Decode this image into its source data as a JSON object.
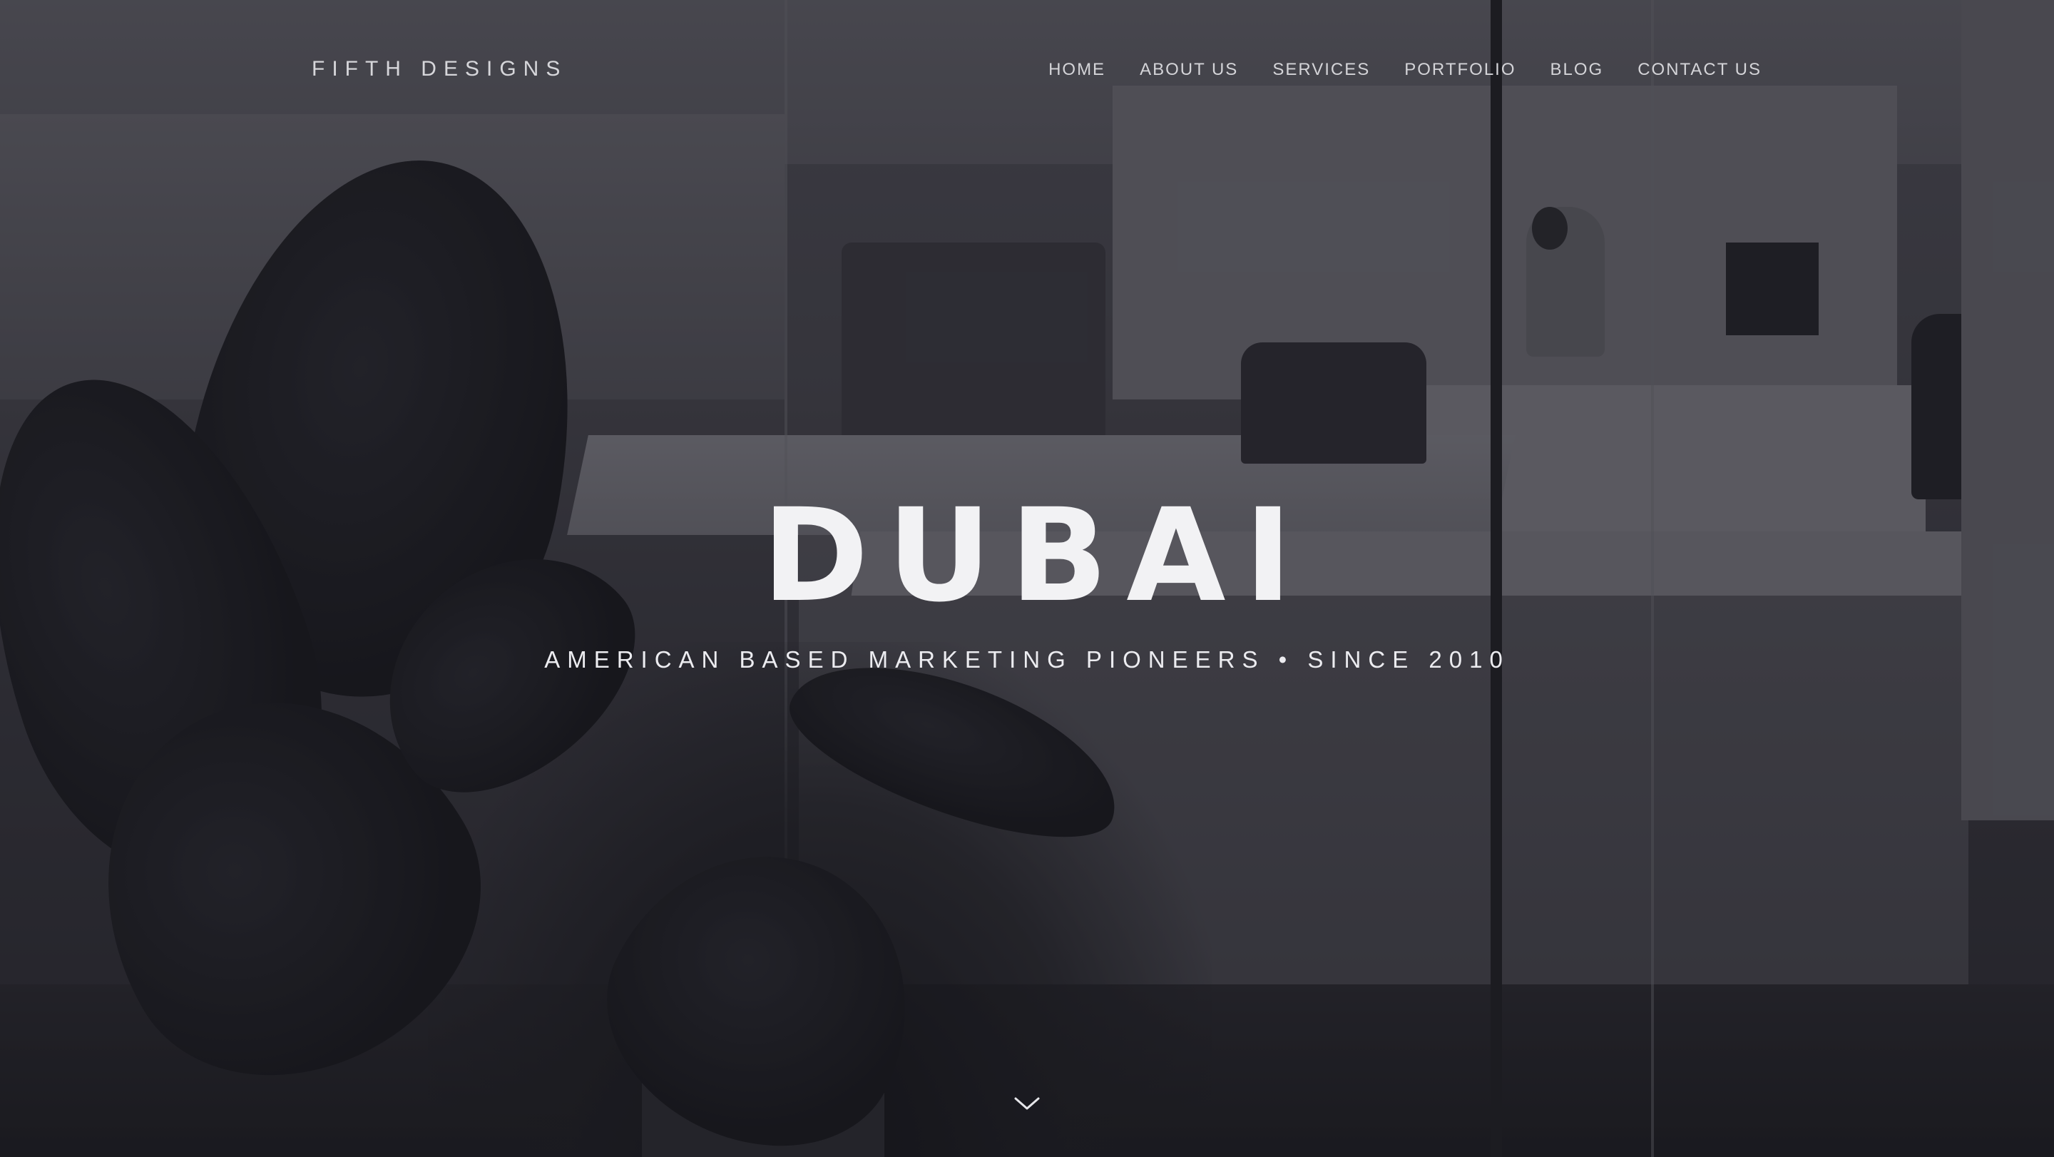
{
  "header": {
    "logo": "FIFTH DESIGNS",
    "nav": [
      "HOME",
      "ABOUT US",
      "SERVICES",
      "PORTFOLIO",
      "BLOG",
      "CONTACT US"
    ]
  },
  "hero": {
    "headline": "DUBAI",
    "tagline": "AMERICAN BASED MARKETING PIONEERS • SINCE 2010",
    "scroll_icon": "chevron-down-icon"
  },
  "colors": {
    "text": "#f2f2f4",
    "nav_text": "#d4d4d8",
    "overlay": "#181820"
  }
}
